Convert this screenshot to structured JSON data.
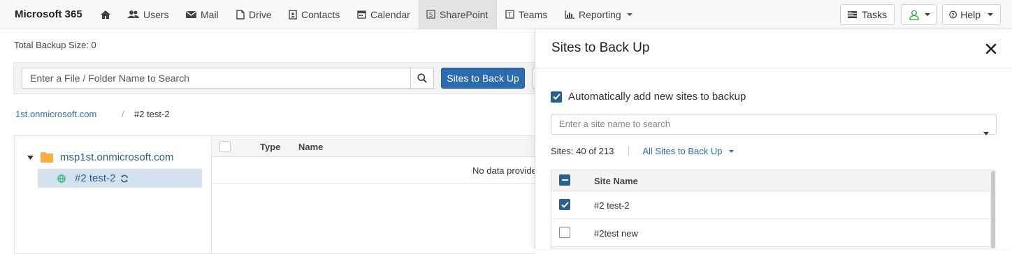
{
  "app": {
    "title": "Microsoft 365"
  },
  "nav": {
    "home_icon": "home-icon",
    "items": [
      {
        "label": "Users",
        "icon": "users-icon"
      },
      {
        "label": "Mail",
        "icon": "mail-icon"
      },
      {
        "label": "Drive",
        "icon": "file-icon"
      },
      {
        "label": "Contacts",
        "icon": "contacts-icon"
      },
      {
        "label": "Calendar",
        "icon": "calendar-icon"
      },
      {
        "label": "SharePoint",
        "icon": "sharepoint-icon",
        "active": true
      },
      {
        "label": "Teams",
        "icon": "teams-icon"
      },
      {
        "label": "Reporting",
        "icon": "chart-icon",
        "dropdown": true
      }
    ],
    "tasks_label": "Tasks",
    "help_label": "Help"
  },
  "main": {
    "total_backup": "Total Backup Size: 0",
    "search_placeholder": "Enter a File / Folder Name to Search",
    "sites_button": "Sites to Back Up",
    "breadcrumb": {
      "root": "1st.onmicrosoft.com",
      "separator": "/",
      "current": "#2 test-2"
    },
    "tree": {
      "root_label": "msp1st.onmicrosoft.com",
      "child_label": "#2 test-2"
    },
    "grid": {
      "columns": [
        "Type",
        "Name"
      ],
      "empty_text": "No data provided"
    }
  },
  "panel": {
    "title": "Sites to Back Up",
    "auto_add_label": "Automatically add new sites to backup",
    "auto_add_checked": true,
    "site_search_placeholder": "Enter a site name to search",
    "sites_count": "Sites: 40 of 213",
    "filter_label": "All Sites to Back Up",
    "table": {
      "column": "Site Name",
      "rows": [
        {
          "name": "#2 test-2",
          "checked": true
        },
        {
          "name": "#2test new",
          "checked": false
        }
      ]
    }
  },
  "colors": {
    "accent": "#2b6cb0",
    "checkbox": "#2b5f8e",
    "tree_selected_bg": "#d4e2ee",
    "folder": "#f5b040",
    "site_globe": "#3aa88a",
    "user_status": "#4caf50"
  }
}
